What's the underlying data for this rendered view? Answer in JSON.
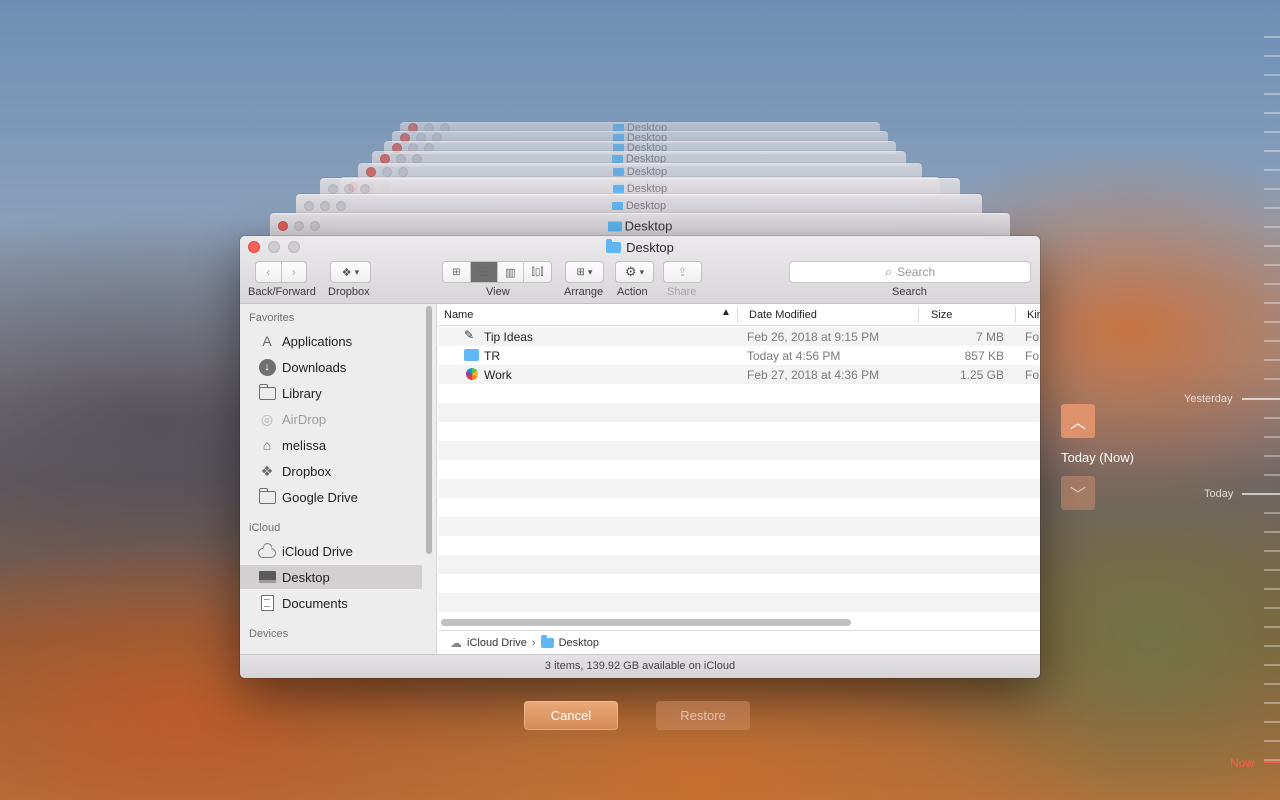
{
  "window": {
    "title": "Desktop"
  },
  "stack_title": "Desktop",
  "toolbar": {
    "back_forward_label": "Back/Forward",
    "dropbox_label": "Dropbox",
    "view_label": "View",
    "arrange_label": "Arrange",
    "action_label": "Action",
    "share_label": "Share",
    "search_label": "Search",
    "search_placeholder": "Search"
  },
  "sidebar": {
    "favorites_header": "Favorites",
    "favorites": [
      {
        "label": "Applications",
        "icon": "applications-icon"
      },
      {
        "label": "Downloads",
        "icon": "downloads-icon"
      },
      {
        "label": "Library",
        "icon": "folder-icon"
      },
      {
        "label": "AirDrop",
        "icon": "airdrop-icon"
      },
      {
        "label": "melissa",
        "icon": "home-icon"
      },
      {
        "label": "Dropbox",
        "icon": "dropbox-icon"
      },
      {
        "label": "Google Drive",
        "icon": "folder-icon"
      }
    ],
    "icloud_header": "iCloud",
    "icloud": [
      {
        "label": "iCloud Drive",
        "icon": "cloud-icon"
      },
      {
        "label": "Desktop",
        "icon": "desktop-icon",
        "selected": true
      },
      {
        "label": "Documents",
        "icon": "documents-icon"
      }
    ],
    "devices_header": "Devices"
  },
  "columns": {
    "name": "Name",
    "date": "Date Modified",
    "size": "Size",
    "kind": "Kind"
  },
  "files": [
    {
      "name": "Tip Ideas",
      "date": "Feb 26, 2018 at 9:15 PM",
      "size": "7 MB",
      "kind": "Fo"
    },
    {
      "name": "TR",
      "date": "Today at 4:56 PM",
      "size": "857 KB",
      "kind": "Fo"
    },
    {
      "name": "Work",
      "date": "Feb 27, 2018 at 4:36 PM",
      "size": "1.25 GB",
      "kind": "Fo"
    }
  ],
  "pathbar": {
    "root": "iCloud Drive",
    "current": "Desktop"
  },
  "status": "3 items, 139.92 GB available on iCloud",
  "buttons": {
    "cancel": "Cancel",
    "restore": "Restore"
  },
  "time_machine": {
    "current_label": "Today (Now)",
    "timeline": {
      "yesterday": "Yesterday",
      "today": "Today",
      "now": "Now"
    }
  },
  "colors": {
    "accent": "#fc605c",
    "now": "#ff5a4a",
    "folder": "#5fb6f2",
    "selection": "#d3d0d2"
  }
}
